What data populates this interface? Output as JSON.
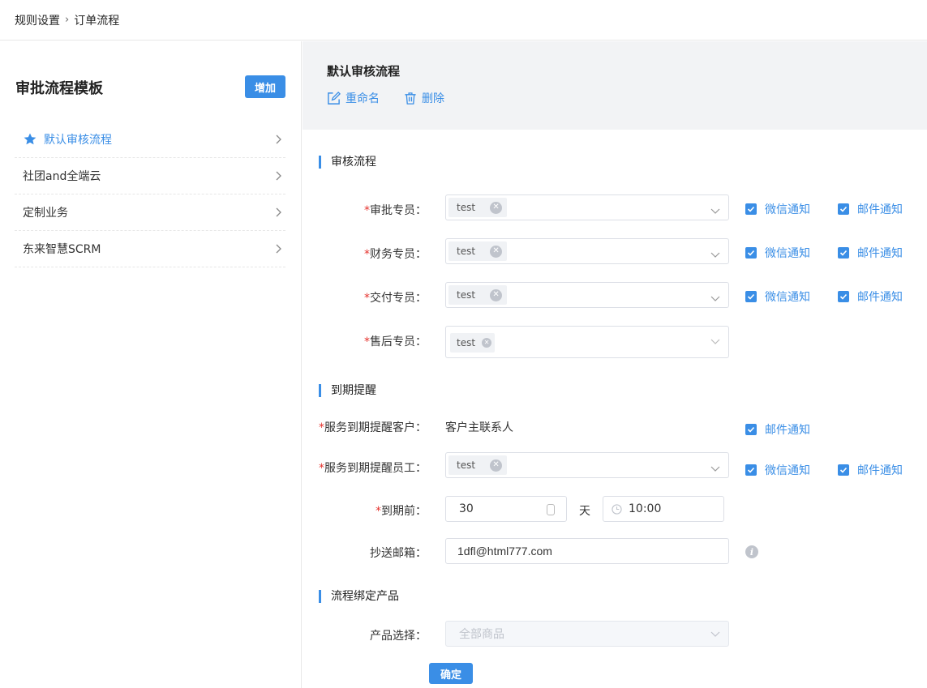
{
  "breadcrumb": {
    "root": "规则设置",
    "separator": "›",
    "current": "订单流程"
  },
  "left_panel": {
    "title": "审批流程模板",
    "add_button": "增加",
    "templates": [
      {
        "label": "默认审核流程",
        "active": true,
        "icon": "star-icon"
      },
      {
        "label": "社团and全端云",
        "active": false
      },
      {
        "label": "定制业务",
        "active": false
      },
      {
        "label": "东来智慧SCRM",
        "active": false
      }
    ]
  },
  "detail": {
    "title": "默认审核流程",
    "rename": "重命名",
    "delete": "删除"
  },
  "section_approval": {
    "title": "审核流程",
    "fields": [
      {
        "label": "审批专员：",
        "tag": "test",
        "wechat": "微信通知",
        "email": "邮件通知"
      },
      {
        "label": "财务专员：",
        "tag": "test",
        "wechat": "微信通知",
        "email": "邮件通知"
      },
      {
        "label": "交付专员：",
        "tag": "test",
        "wechat": "微信通知",
        "email": "邮件通知"
      },
      {
        "label": "售后专员：",
        "tag": "test"
      }
    ]
  },
  "section_expiry": {
    "title": "到期提醒",
    "customer_label": "服务到期提醒客户：",
    "customer_value": "客户主联系人",
    "customer_email": "邮件通知",
    "employee_label": "服务到期提醒员工：",
    "employee_tag": "test",
    "employee_wechat": "微信通知",
    "employee_email": "邮件通知",
    "before_label": "到期前：",
    "before_value": "30",
    "before_unit": "天",
    "time_value": "10:00",
    "cc_label": "抄送邮箱：",
    "cc_value": "1dfl@html777.com"
  },
  "section_product": {
    "title": "流程绑定产品",
    "product_label": "产品选择：",
    "product_value": "全部商品"
  },
  "confirm_button": "确定",
  "required_mark": "*",
  "colors": {
    "accent": "#3a8ee6",
    "required": "#e5322d",
    "header_bg": "#f2f3f5"
  }
}
